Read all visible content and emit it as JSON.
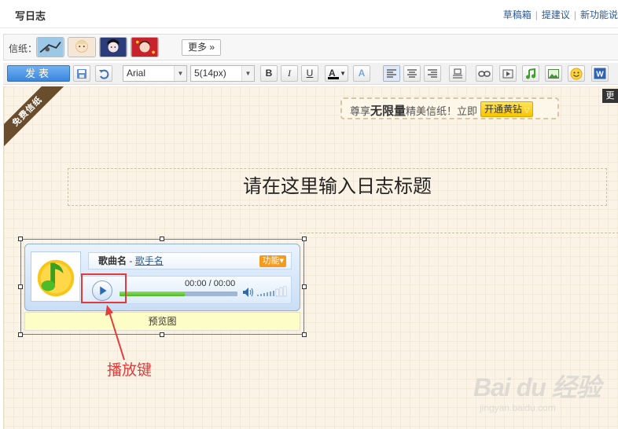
{
  "header": {
    "title": "写日志",
    "links": [
      "草稿箱",
      "提建议",
      "新功能说"
    ]
  },
  "stationery": {
    "label": "信纸：",
    "thumbnails": [
      "stationery-thumb-1",
      "stationery-thumb-2",
      "stationery-thumb-3",
      "stationery-thumb-4"
    ],
    "more_label": "更多"
  },
  "toolbar": {
    "publish_label": "发表",
    "font_family": "Arial",
    "font_size": "5(14px)",
    "bold": "B",
    "italic": "I",
    "underline": "U",
    "font_color": "A",
    "font_bg": "A",
    "icons": [
      "save-icon",
      "undo-icon",
      "align-left-icon",
      "align-center-icon",
      "align-right-icon",
      "paragraph-icon",
      "link-icon",
      "video-icon",
      "music-icon",
      "image-icon",
      "emoji-icon",
      "word-icon"
    ]
  },
  "editor": {
    "ribbon_text": "免费信纸",
    "promo": {
      "prefix": "尊享",
      "highlight": "无限量",
      "suffix": "精美信纸！立即",
      "button": "开通黄钻"
    },
    "side_tab": "更",
    "title_placeholder": "请在这里输入日志标题",
    "player": {
      "song_name": "歌曲名",
      "separator": "-",
      "singer": "歌手名",
      "func_label": "功能▾",
      "time": "00:00 / 00:00",
      "progress_fraction": 0.55
    },
    "preview_label": "预览图",
    "annotation": "播放键",
    "accent_color": "#e23b3b"
  },
  "watermark": {
    "main": "Bai du 经验",
    "sub": "jingyan.baidu.com"
  }
}
